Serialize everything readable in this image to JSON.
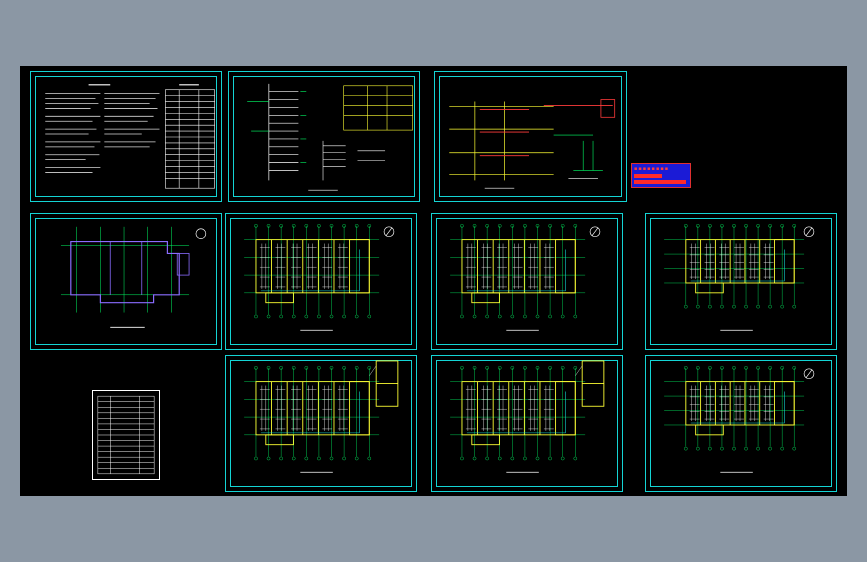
{
  "colors": {
    "background": "#8b97a4",
    "canvas": "#000000",
    "frame": "#14d4d4",
    "wall": "#ffff33",
    "grid": "#00ff66",
    "text": "#ffffff",
    "accent": "#ff3b3b"
  },
  "sheets": [
    {
      "id": "design-notes",
      "kind": "notes"
    },
    {
      "id": "system-diagram-a",
      "kind": "riser"
    },
    {
      "id": "system-diagram-b",
      "kind": "riser"
    },
    {
      "id": "plan-overview",
      "kind": "plan-simple"
    },
    {
      "id": "plan-1",
      "kind": "plan"
    },
    {
      "id": "plan-2",
      "kind": "plan"
    },
    {
      "id": "plan-3",
      "kind": "plan-small"
    },
    {
      "id": "plan-4",
      "kind": "plan-annex"
    },
    {
      "id": "plan-5",
      "kind": "plan-annex"
    },
    {
      "id": "plan-6",
      "kind": "plan-small"
    }
  ],
  "stamp": {
    "icon": "seal-stamp-icon"
  },
  "legend_table": {
    "rows": 14
  }
}
